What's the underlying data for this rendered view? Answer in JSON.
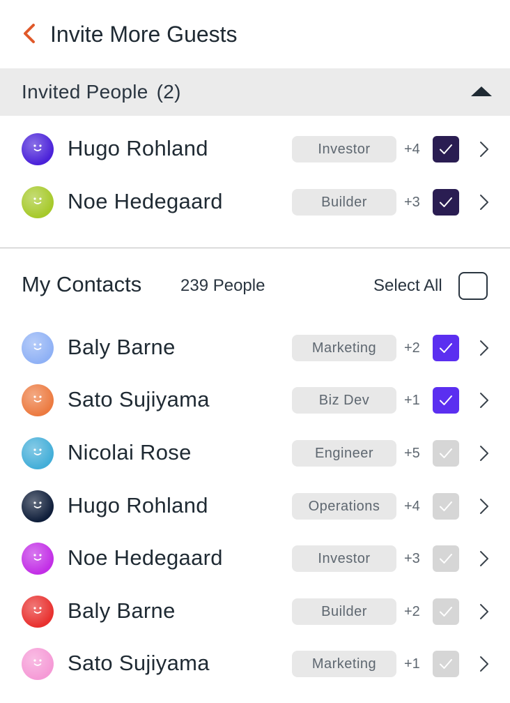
{
  "header": {
    "title": "Invite More Guests",
    "back_icon": "chevron-left-icon",
    "back_color": "#e0592a"
  },
  "invited": {
    "label": "Invited People",
    "count": "(2)",
    "toggle_icon": "caret-up-icon",
    "rows": [
      {
        "name": "Hugo Rohland",
        "tag": "Investor",
        "extra": "+4",
        "checked": true,
        "avatar_color": "#4a21d9"
      },
      {
        "name": "Noe Hedegaard",
        "tag": "Builder",
        "extra": "+3",
        "checked": true,
        "avatar_color": "#a6c92a"
      }
    ]
  },
  "contacts": {
    "title": "My Contacts",
    "count": "239 People",
    "select_all": "Select All",
    "rows": [
      {
        "name": "Baly Barne",
        "tag": "Marketing",
        "extra": "+2",
        "checked": true,
        "avatar_color": "#8fb1f5"
      },
      {
        "name": "Sato Sujiyama",
        "tag": "Biz Dev",
        "extra": "+1",
        "checked": true,
        "avatar_color": "#ec7a40"
      },
      {
        "name": "Nicolai Rose",
        "tag": "Engineer",
        "extra": "+5",
        "checked": false,
        "avatar_color": "#43aed8"
      },
      {
        "name": "Hugo Rohland",
        "tag": "Operations",
        "extra": "+4",
        "checked": false,
        "avatar_color": "#0f1e3a"
      },
      {
        "name": "Noe Hedegaard",
        "tag": "Investor",
        "extra": "+3",
        "checked": false,
        "avatar_color": "#c22ee6"
      },
      {
        "name": "Baly Barne",
        "tag": "Builder",
        "extra": "+2",
        "checked": false,
        "avatar_color": "#e8302e"
      },
      {
        "name": "Sato Sujiyama",
        "tag": "Marketing",
        "extra": "+1",
        "checked": false,
        "avatar_color": "#f59ad6"
      }
    ]
  },
  "colors": {
    "checked_invited": "#2a1d52",
    "checked_contact": "#5b2ff0",
    "unchecked": "#d6d6d6",
    "section_bar": "#ebebeb"
  }
}
